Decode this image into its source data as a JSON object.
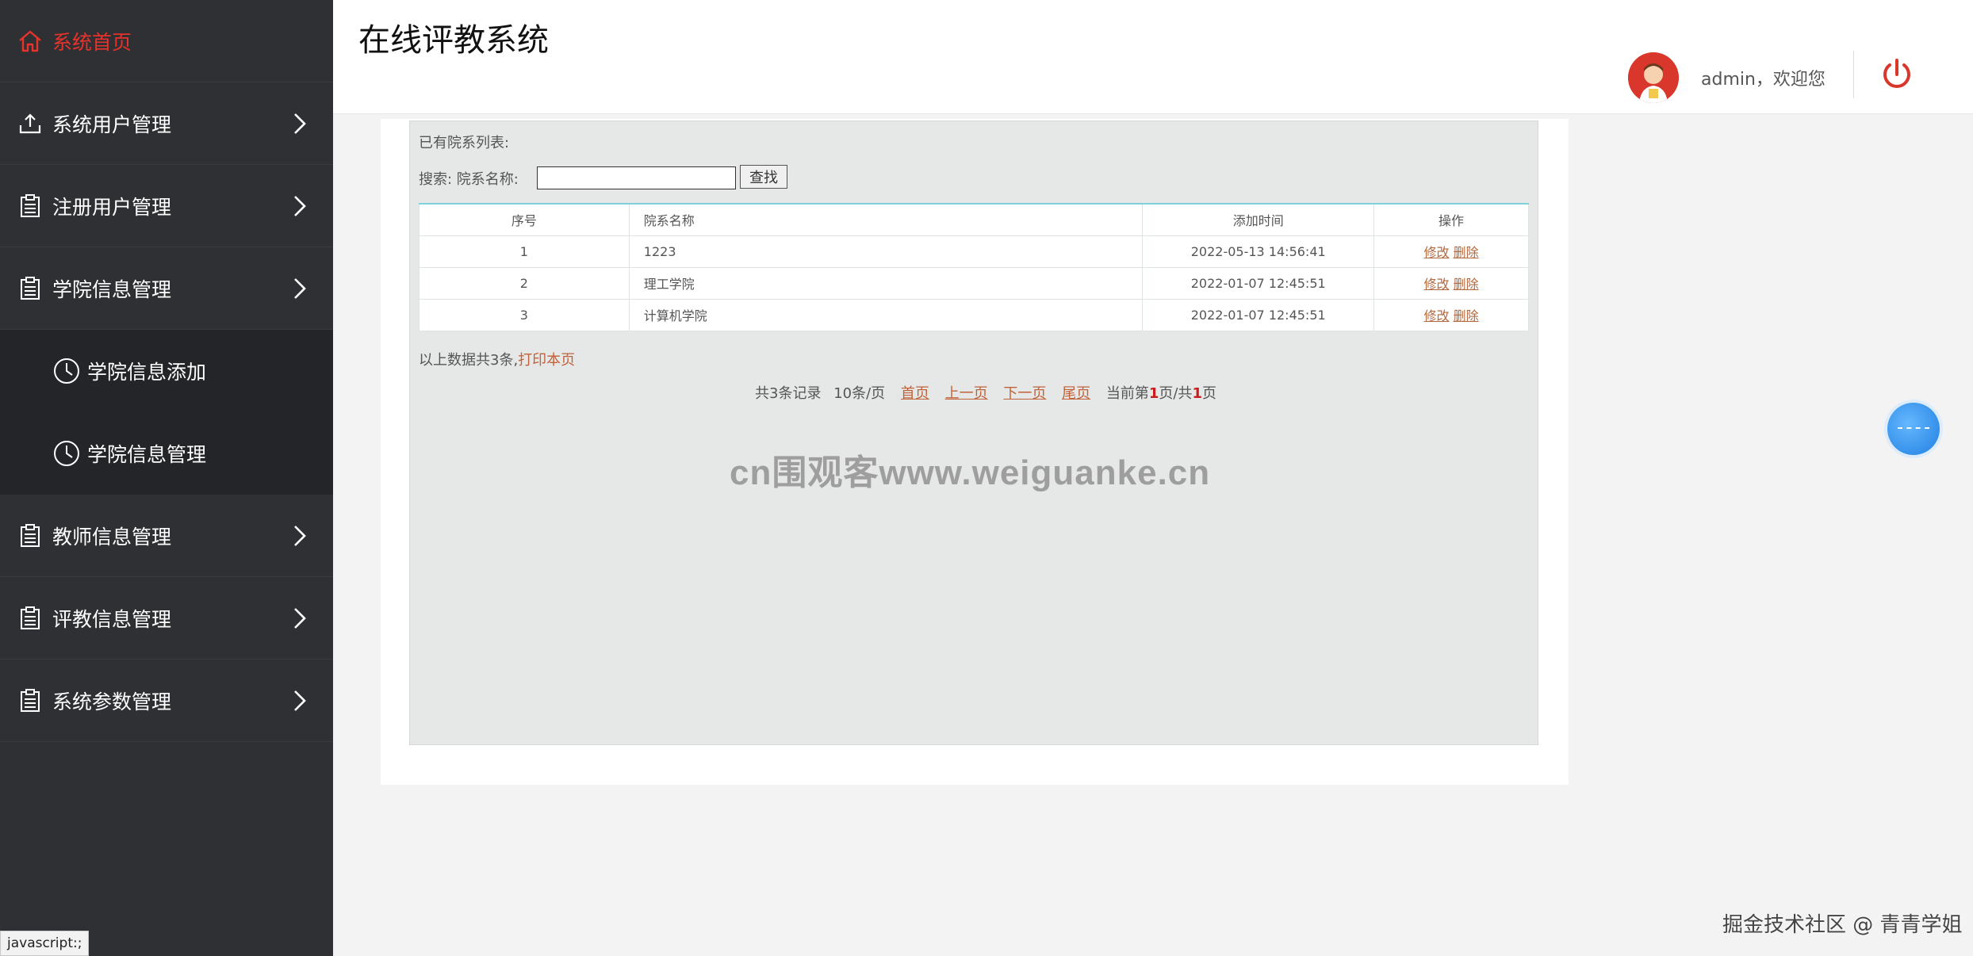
{
  "sidebar": {
    "home": "系统首页",
    "items": [
      {
        "label": "系统用户管理",
        "icon": "upload-icon"
      },
      {
        "label": "注册用户管理",
        "icon": "clipboard-icon"
      },
      {
        "label": "学院信息管理",
        "icon": "clipboard-icon"
      },
      {
        "label": "教师信息管理",
        "icon": "clipboard-icon"
      },
      {
        "label": "评教信息管理",
        "icon": "clipboard-icon"
      },
      {
        "label": "系统参数管理",
        "icon": "clipboard-icon"
      }
    ],
    "submenu": [
      {
        "label": "学院信息添加",
        "icon": "clock-icon"
      },
      {
        "label": "学院信息管理",
        "icon": "clock-icon"
      }
    ]
  },
  "header": {
    "title": "在线评教系统",
    "welcome": "admin，欢迎您"
  },
  "content": {
    "list_title": "已有院系列表:",
    "search_label": "搜索: 院系名称:",
    "search_value": "",
    "search_button": "查找",
    "table": {
      "headers": [
        "序号",
        "院系名称",
        "添加时间",
        "操作"
      ],
      "rows": [
        {
          "no": "1",
          "name": "1223",
          "time": "2022-05-13 14:56:41"
        },
        {
          "no": "2",
          "name": "理工学院",
          "time": "2022-01-07 12:45:51"
        },
        {
          "no": "3",
          "name": "计算机学院",
          "time": "2022-01-07 12:45:51"
        }
      ],
      "edit_label": "修改",
      "delete_label": "删除"
    },
    "summary_prefix": "以上数据共3条,",
    "print_link": "打印本页",
    "pagination": {
      "total": "共3条记录",
      "per_page": "10条/页",
      "first": "首页",
      "prev": "上一页",
      "next": "下一页",
      "last": "尾页",
      "current_prefix": "当前第",
      "current_page": "1",
      "mid": "页/共",
      "total_pages": "1",
      "suffix": "页"
    }
  },
  "watermark": "cn围观客www.weiguanke.cn",
  "status_bar": "javascript:;",
  "credit": "掘金技术社区 @ 青青学姐",
  "colors": {
    "sidebar_bg": "#2f3033",
    "active": "#e8322a",
    "link": "#c0623a",
    "table_top_border": "#7fd0d8"
  }
}
